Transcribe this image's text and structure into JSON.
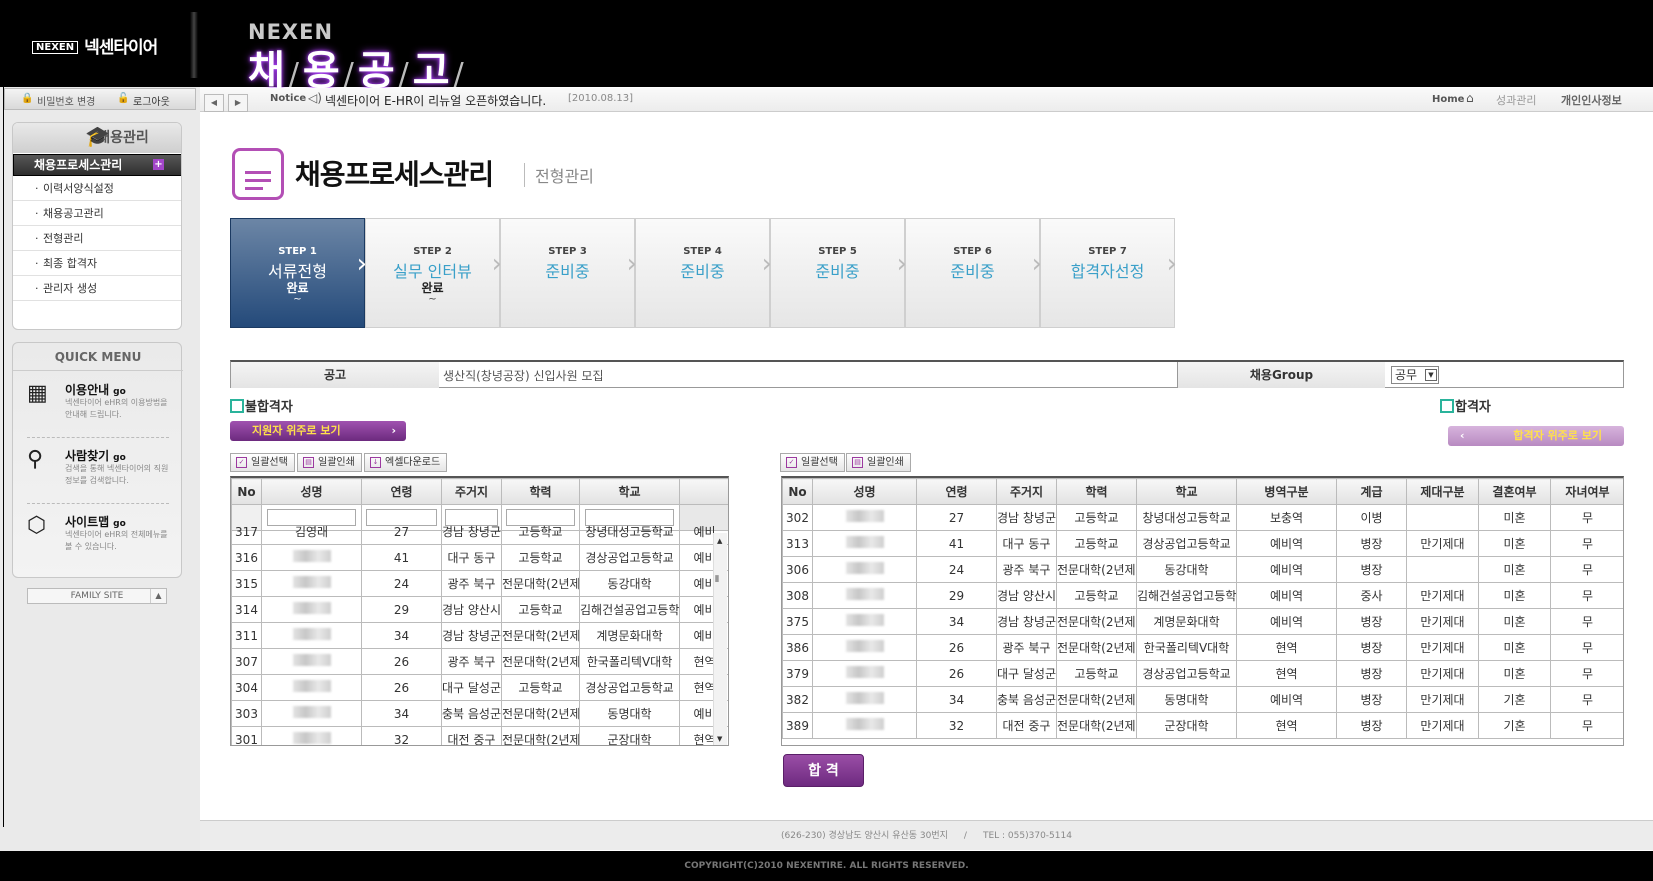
{
  "header": {
    "logo_box": "NEXEN",
    "logo_text": "넥센타이어",
    "brand": "NEXEN",
    "title_chars": [
      "채",
      "용",
      "공",
      "고"
    ]
  },
  "util": {
    "pw_change": "비밀번호 변경",
    "logout": "로그아웃"
  },
  "notice": {
    "label": "Notice",
    "text": "넥센타이어 E-HR이 리뉴얼 오픈하였습니다.",
    "date": "[2010.08.13]",
    "bc_home": "Home",
    "bc_mid": "성과관리",
    "bc_last": "개인인사정보"
  },
  "sidebar": {
    "head": "채용관리",
    "selected": "채용프로세스관리",
    "plus": "+",
    "items": [
      "이력서양식설정",
      "채용공고관리",
      "전형관리",
      "최종 합격자",
      "관리자 생성"
    ]
  },
  "quick": {
    "head": "QUICK MENU",
    "go": "go",
    "items": [
      {
        "title": "이용안내",
        "desc": "넥센타이어 eHR의 이용방법을 안내해 드립니다.",
        "icon": "calendar-icon"
      },
      {
        "title": "사람찾기",
        "desc": "검색을 통해 넥센타이어의 직원정보를 검색합니다.",
        "icon": "people-icon"
      },
      {
        "title": "사이트맵",
        "desc": "넥센타이어 eHR의 전체메뉴를 볼 수 있습니다.",
        "icon": "cube-icon"
      }
    ],
    "family": "FAMILY SITE"
  },
  "page": {
    "title": "채용프로세스관리",
    "sub": "전형관리"
  },
  "steps": [
    {
      "no": "STEP 1",
      "title": "서류전형",
      "status": "완료",
      "tilde": "~",
      "active": true
    },
    {
      "no": "STEP 2",
      "title": "실무 인터뷰",
      "status": "완료",
      "tilde": "~",
      "active": false
    },
    {
      "no": "STEP 3",
      "title": "준비중",
      "status": "",
      "tilde": "",
      "active": false
    },
    {
      "no": "STEP 4",
      "title": "준비중",
      "status": "",
      "tilde": "",
      "active": false
    },
    {
      "no": "STEP 5",
      "title": "준비중",
      "status": "",
      "tilde": "",
      "active": false
    },
    {
      "no": "STEP 6",
      "title": "준비중",
      "status": "",
      "tilde": "",
      "active": false
    },
    {
      "no": "STEP 7",
      "title": "합격자선정",
      "status": "",
      "tilde": "",
      "active": false
    }
  ],
  "info": {
    "notice_label": "공고",
    "notice_value": "생산직(창녕공장) 신입사원 모집",
    "group_label": "채용Group",
    "group_value": "공무"
  },
  "left": {
    "label": "불합격자",
    "view_btn": "지원자 위주로 보기",
    "sel_all": "일괄선택",
    "print_all": "일괄인쇄",
    "excel": "엑셀다운로드",
    "headers": [
      "No",
      "성명",
      "연령",
      "주거지",
      "학력",
      "학교",
      ""
    ],
    "rows": [
      [
        "317",
        "김영래",
        "27",
        "경남 창녕군",
        "고등학교",
        "창녕대성고등학교",
        "예비"
      ],
      [
        "316",
        "",
        "41",
        "대구 동구",
        "고등학교",
        "경상공업고등학교",
        "예비"
      ],
      [
        "315",
        "",
        "24",
        "광주 북구",
        "전문대학(2년제)",
        "동강대학",
        "예비"
      ],
      [
        "314",
        "",
        "29",
        "경남 양산시",
        "고등학교",
        "김해건설공업고등학교",
        "예비"
      ],
      [
        "311",
        "",
        "34",
        "경남 창녕군",
        "전문대학(2년제)",
        "계명문화대학",
        "예비"
      ],
      [
        "307",
        "",
        "26",
        "광주 북구",
        "전문대학(2년제)",
        "한국폴리텍V대학",
        "현역"
      ],
      [
        "304",
        "",
        "26",
        "대구 달성군",
        "고등학교",
        "경상공업고등학교",
        "현역"
      ],
      [
        "303",
        "",
        "34",
        "충북 음성군",
        "전문대학(2년제)",
        "동명대학",
        "예비"
      ],
      [
        "301",
        "",
        "32",
        "대전 중구",
        "전문대학(2년제)",
        "군장대학",
        "현역"
      ]
    ]
  },
  "right": {
    "label": "합격자",
    "view_btn": "합격자 위주로 보기",
    "sel_all": "일괄선택",
    "print_all": "일괄인쇄",
    "headers": [
      "No",
      "성명",
      "연령",
      "주거지",
      "학력",
      "학교",
      "병역구분",
      "계급",
      "제대구분",
      "결혼여부",
      "자녀여부"
    ],
    "rows": [
      [
        "302",
        "",
        "27",
        "경남 창녕군",
        "고등학교",
        "창녕대성고등학교",
        "보충역",
        "이병",
        "",
        "미혼",
        "무"
      ],
      [
        "313",
        "",
        "41",
        "대구 동구",
        "고등학교",
        "경상공업고등학교",
        "예비역",
        "병장",
        "만기제대",
        "미혼",
        "무"
      ],
      [
        "306",
        "",
        "24",
        "광주 북구",
        "전문대학(2년제)",
        "동강대학",
        "예비역",
        "병장",
        "",
        "미혼",
        "무"
      ],
      [
        "308",
        "",
        "29",
        "경남 양산시",
        "고등학교",
        "김해건설공업고등학교",
        "예비역",
        "중사",
        "만기제대",
        "미혼",
        "무"
      ],
      [
        "375",
        "",
        "34",
        "경남 창녕군",
        "전문대학(2년제)",
        "계명문화대학",
        "예비역",
        "병장",
        "만기제대",
        "미혼",
        "무"
      ],
      [
        "386",
        "",
        "26",
        "광주 북구",
        "전문대학(2년제)",
        "한국폴리텍V대학",
        "현역",
        "병장",
        "만기제대",
        "미혼",
        "무"
      ],
      [
        "379",
        "",
        "26",
        "대구 달성군",
        "고등학교",
        "경상공업고등학교",
        "현역",
        "병장",
        "만기제대",
        "미혼",
        "무"
      ],
      [
        "382",
        "",
        "34",
        "충북 음성군",
        "전문대학(2년제)",
        "동명대학",
        "예비역",
        "병장",
        "만기제대",
        "기혼",
        "무"
      ],
      [
        "389",
        "",
        "32",
        "대전 중구",
        "전문대학(2년제)",
        "군장대학",
        "현역",
        "병장",
        "만기제대",
        "기혼",
        "무"
      ]
    ]
  },
  "pass_btn": "합 격",
  "footer": {
    "address": "(626-230) 경상남도 양산시 유산동 30번지",
    "tel": "TEL : 055)370-5114",
    "sep": "/",
    "copyright": "COPYRIGHT(C)2010 NEXENTIRE. ALL RIGHTS RESERVED."
  }
}
